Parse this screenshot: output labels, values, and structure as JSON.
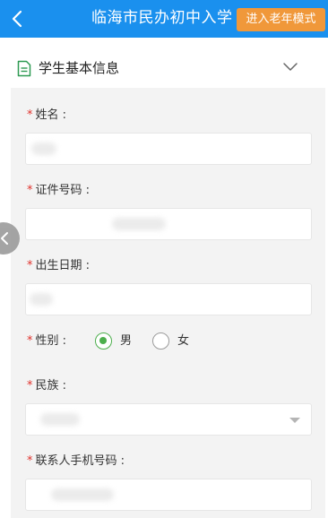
{
  "header": {
    "title": "临海市民办初中入学",
    "elder_mode_label": "进入老年模式",
    "back_icon": "chevron-left-icon",
    "bg_color": "#1a90ee",
    "accent_color": "#f0983a"
  },
  "section": {
    "title": "学生基本信息",
    "icon": "document-icon",
    "toggle_icon": "chevron-down-icon"
  },
  "form": {
    "required_mark": "*",
    "name_label": "姓名 :",
    "id_label": "证件号码 :",
    "birth_label": "出生日期 :",
    "gender_label": "性别 :",
    "gender_options": [
      "男",
      "女"
    ],
    "gender_selected": "男",
    "ethnicity_label": "民族 :",
    "phone_label": "联系人手机号码 :"
  },
  "colors": {
    "required": "#e0322c",
    "radio_checked": "#4cae4c",
    "form_bg": "#f3f3f3"
  }
}
